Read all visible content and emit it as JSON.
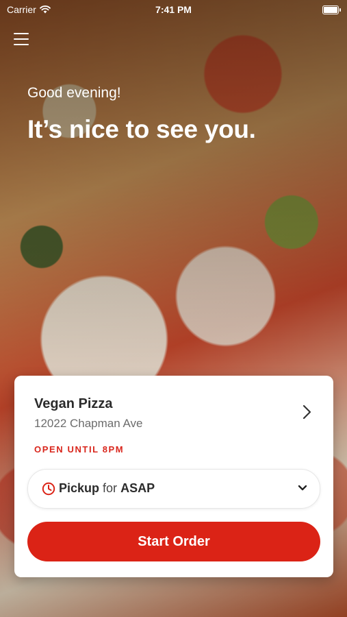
{
  "status_bar": {
    "carrier": "Carrier",
    "time": "7:41 PM"
  },
  "hero": {
    "greeting": "Good evening!",
    "headline": "It’s nice to see you."
  },
  "store": {
    "name": "Vegan Pizza",
    "address": "12022 Chapman Ave",
    "open_status": "OPEN UNTIL 8PM"
  },
  "order": {
    "method": "Pickup",
    "connector": "for",
    "time": "ASAP",
    "start_label": "Start Order"
  },
  "colors": {
    "accent": "#db2316",
    "open_status": "#d9261c"
  },
  "icons": {
    "menu": "hamburger-menu-icon",
    "wifi": "wifi-icon",
    "battery": "battery-icon",
    "chevron": "chevron-right-icon",
    "clock": "clock-icon",
    "dropdown": "chevron-down-icon"
  }
}
